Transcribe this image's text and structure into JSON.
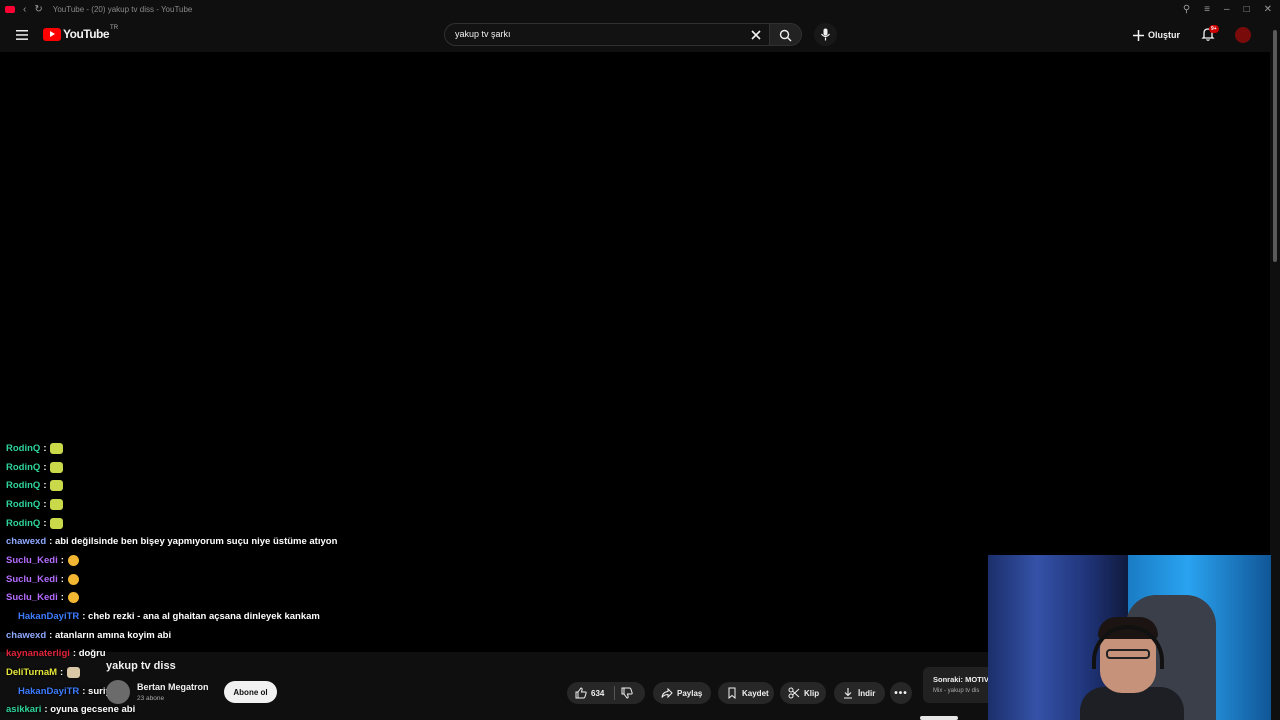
{
  "window": {
    "title": "YouTube - (20) yakup tv diss - YouTube"
  },
  "masthead": {
    "logo_text": "YouTube",
    "region": "TR",
    "search_value": "yakup tv şarkı",
    "create_label": "Oluştur",
    "notification_badge": "9+"
  },
  "chat": [
    {
      "user": "RodinQ",
      "color": "#2fd39a",
      "msg": ":",
      "emote": "green"
    },
    {
      "user": "RodinQ",
      "color": "#2fd39a",
      "msg": ":",
      "emote": "green"
    },
    {
      "user": "RodinQ",
      "color": "#2fd39a",
      "msg": ":",
      "emote": "green"
    },
    {
      "user": "RodinQ",
      "color": "#2fd39a",
      "msg": ":",
      "emote": "green"
    },
    {
      "user": "RodinQ",
      "color": "#2fd39a",
      "msg": ":",
      "emote": "green"
    },
    {
      "user": "chawexd",
      "color": "#8fa9ff",
      "msg": ": abi değilsinde ben bişey yapmıyorum suçu niye üstüme atıyon",
      "emote": ""
    },
    {
      "user": "Suclu_Kedi",
      "color": "#b46cff",
      "msg": ":",
      "emote": "hand"
    },
    {
      "user": "Suclu_Kedi",
      "color": "#b46cff",
      "msg": ":",
      "emote": "hand"
    },
    {
      "user": "Suclu_Kedi",
      "color": "#b46cff",
      "msg": ":",
      "emote": "hand"
    },
    {
      "user": "HakanDayiTR",
      "color": "#3d7cff",
      "msg": ": cheb rezki - ana al ghaitan açsana dinleyek kankam",
      "emote": ""
    },
    {
      "user": "chawexd",
      "color": "#8fa9ff",
      "msg": ": atanların amına koyim abi",
      "emote": ""
    },
    {
      "user": "kaynanaterligi",
      "color": "#e0233a",
      "msg": ": doğru",
      "emote": ""
    },
    {
      "user": "DeliTurnaM",
      "color": "#e5e63a",
      "msg": ":",
      "emote": "pic"
    },
    {
      "user": "HakanDayiTR",
      "color": "#3d7cff",
      "msg": ": suriye",
      "emote": ""
    },
    {
      "user": "asikkari",
      "color": "#2fd39a",
      "msg": ": oyuna gecsene abi",
      "emote": ""
    }
  ],
  "video": {
    "title": "yakup tv diss",
    "channel": "Bertan Megatron",
    "subscribers": "23 abone",
    "subscribe_label": "Abone ol",
    "likes": "634",
    "share_label": "Paylaş",
    "save_label": "Kaydet",
    "clip_label": "Klip",
    "download_label": "İndir"
  },
  "next": {
    "label": "Sonraki: MOTIV",
    "sub": "Mix - yakup tv dis"
  }
}
